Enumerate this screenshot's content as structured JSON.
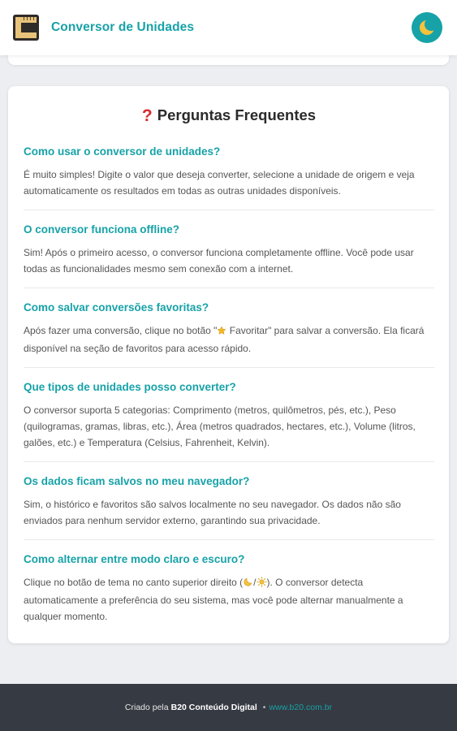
{
  "header": {
    "title": "Conversor de Unidades",
    "logo_icon": "ruler-logo-icon",
    "theme_toggle_icon": "moon-icon"
  },
  "faq": {
    "title": "Perguntas Frequentes",
    "title_icon": "question-mark-icon",
    "items": [
      {
        "q": "Como usar o conversor de unidades?",
        "a": "É muito simples! Digite o valor que deseja converter, selecione a unidade de origem e veja automaticamente os resultados em todas as outras unidades disponíveis."
      },
      {
        "q": "O conversor funciona offline?",
        "a": "Sim! Após o primeiro acesso, o conversor funciona completamente offline. Você pode usar todas as funcionalidades mesmo sem conexão com a internet."
      },
      {
        "q": "Como salvar conversões favoritas?",
        "a_before": "Após fazer uma conversão, clique no botão \"",
        "a_icon": "star-icon",
        "a_mid": " Favoritar\" para salvar a conversão. Ela ficará disponível na seção de favoritos para acesso rápido."
      },
      {
        "q": "Que tipos de unidades posso converter?",
        "a": "O conversor suporta 5 categorias: Comprimento (metros, quilômetros, pés, etc.), Peso (quilogramas, gramas, libras, etc.), Área (metros quadrados, hectares, etc.), Volume (litros, galões, etc.) e Temperatura (Celsius, Fahrenheit, Kelvin)."
      },
      {
        "q": "Os dados ficam salvos no meu navegador?",
        "a": "Sim, o histórico e favoritos são salvos localmente no seu navegador. Os dados não são enviados para nenhum servidor externo, garantindo sua privacidade."
      },
      {
        "q": "Como alternar entre modo claro e escuro?",
        "a_before": "Clique no botão de tema no canto superior direito (",
        "a_icon1": "moon-icon",
        "a_slash": "/",
        "a_icon2": "sun-icon",
        "a_mid": "). O conversor detecta automaticamente a preferência do seu sistema, mas você pode alternar manualmente a qualquer momento."
      }
    ]
  },
  "footer": {
    "prefix": "Criado pela",
    "brand": "B20 Conteúdo Digital",
    "separator": "•",
    "link": "www.b20.com.br"
  },
  "colors": {
    "accent": "#17a2a8",
    "footer_bg": "#363a42",
    "page_bg": "#eceef1"
  }
}
